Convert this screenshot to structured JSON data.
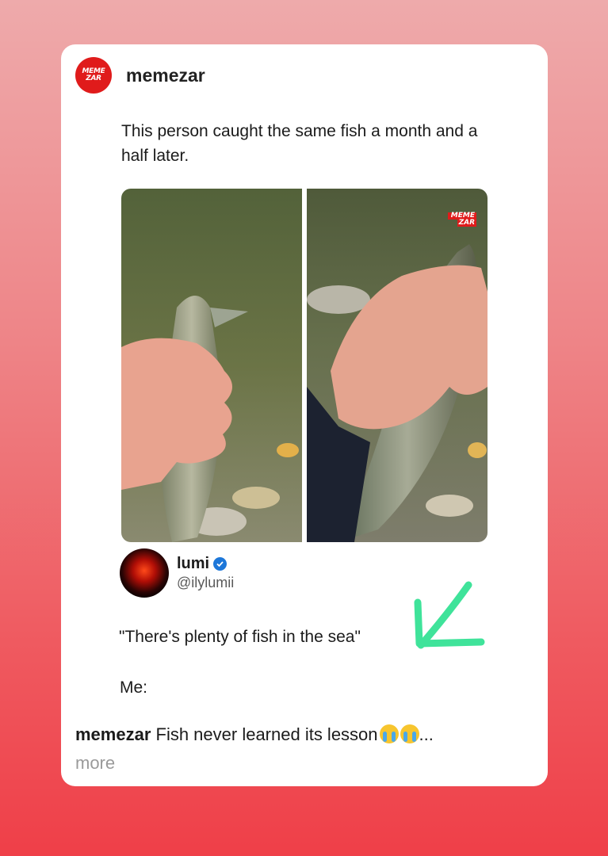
{
  "post": {
    "account_name": "memezar",
    "avatar_logo_top": "MEME",
    "avatar_logo_bottom": "ZAR",
    "tweet_text": "This person caught the same fish a month and a half later.",
    "watermark_top": "MEME",
    "watermark_bottom": "ZAR"
  },
  "quote": {
    "name": "lumi",
    "handle": "@ilylumii",
    "line1": "\"There's plenty of fish in the sea\"",
    "line2": "Me:"
  },
  "caption": {
    "username": "memezar",
    "text": " Fish never learned its lesson",
    "ellipsis": "...",
    "more": "more"
  },
  "colors": {
    "brand_red": "#e01b1b",
    "arrow_green": "#3fe39a",
    "verified_blue": "#1d77d9"
  },
  "icons": {
    "verified": "verified-badge-icon",
    "arrow": "green-arrow-icon",
    "emoji": "loudly-crying-face-icon"
  }
}
